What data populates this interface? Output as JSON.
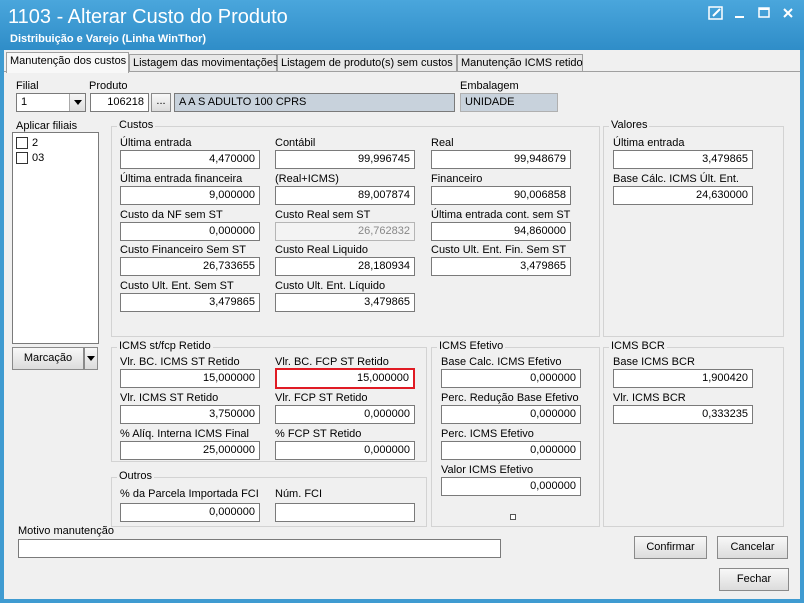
{
  "window": {
    "title": "1103 - Alterar Custo do Produto",
    "subtitle": "Distribuição e Varejo (Linha WinThor)"
  },
  "tabs": [
    {
      "label": "Manutenção dos custos"
    },
    {
      "label": "Listagem das movimentações"
    },
    {
      "label": "Listagem de produto(s)  sem custos"
    },
    {
      "label": "Manutenção ICMS retido"
    }
  ],
  "header": {
    "filial_label": "Filial",
    "filial_value": "1",
    "produto_label": "Produto",
    "produto_code": "106218",
    "browse_label": "...",
    "produto_desc": "A A S ADULTO 100 CPRS",
    "embalagem_label": "Embalagem",
    "embalagem_value": "UNIDADE"
  },
  "aplicar_filiais": {
    "label": "Aplicar filiais",
    "items": [
      {
        "label": "2",
        "checked": false
      },
      {
        "label": "03",
        "checked": false
      }
    ],
    "marcacao_label": "Marcação"
  },
  "custos": {
    "title": "Custos",
    "fields": {
      "ultima_entrada": {
        "label": "Última entrada",
        "value": "4,470000"
      },
      "contabil": {
        "label": "Contábil",
        "value": "99,996745"
      },
      "real": {
        "label": "Real",
        "value": "99,948679"
      },
      "ultima_entrada_financeira": {
        "label": "Última entrada financeira",
        "value": "9,000000"
      },
      "real_icms": {
        "label": "(Real+ICMS)",
        "value": "89,007874"
      },
      "financeiro": {
        "label": "Financeiro",
        "value": "90,006858"
      },
      "custo_nf_sem_st": {
        "label": "Custo da NF sem ST",
        "value": "0,000000"
      },
      "custo_real_sem_st": {
        "label": "Custo Real sem ST",
        "value": "26,762832"
      },
      "ultima_entrada_cont_sem_st": {
        "label": "Última entrada cont. sem ST",
        "value": "94,860000"
      },
      "custo_financeiro_sem_st": {
        "label": "Custo Financeiro Sem ST",
        "value": "26,733655"
      },
      "custo_real_liquido": {
        "label": "Custo Real Liquido",
        "value": "28,180934"
      },
      "custo_ult_ent_fin_sem_st": {
        "label": "Custo Ult. Ent. Fin. Sem ST",
        "value": "3,479865"
      },
      "custo_ult_ent_sem_st": {
        "label": "Custo Ult. Ent. Sem ST",
        "value": "3,479865"
      },
      "custo_ult_ent_liquido": {
        "label": "Custo Ult. Ent. Líquido",
        "value": "3,479865"
      }
    }
  },
  "valores": {
    "title": "Valores",
    "ultima_entrada": {
      "label": "Última entrada",
      "value": "3,479865"
    },
    "base_calc_icms": {
      "label": "Base Cálc. ICMS Últ. Ent.",
      "value": "24,630000"
    }
  },
  "icms_st": {
    "title": "ICMS st/fcp Retido",
    "vlr_bc_icms_st": {
      "label": "Vlr. BC. ICMS ST Retido",
      "value": "15,000000"
    },
    "vlr_bc_fcp_st": {
      "label": "Vlr. BC. FCP ST Retido",
      "value": "15,000000"
    },
    "vlr_icms_st": {
      "label": "Vlr. ICMS ST Retido",
      "value": "3,750000"
    },
    "vlr_fcp_st": {
      "label": "Vlr. FCP ST Retido",
      "value": "0,000000"
    },
    "aliq_interna": {
      "label": "% Alíq. Interna ICMS Final",
      "value": "25,000000"
    },
    "fcp_st": {
      "label": "% FCP ST Retido",
      "value": "0,000000"
    }
  },
  "icms_efetivo": {
    "title": "ICMS Efetivo",
    "base_calc": {
      "label": "Base Calc. ICMS Efetivo",
      "value": "0,000000"
    },
    "perc_reducao": {
      "label": "Perc. Redução Base Efetivo",
      "value": "0,000000"
    },
    "perc_icms": {
      "label": "Perc. ICMS Efetivo",
      "value": "0,000000"
    },
    "valor_icms": {
      "label": "Valor ICMS Efetivo",
      "value": "0,000000"
    }
  },
  "icms_bcr": {
    "title": "ICMS BCR",
    "base": {
      "label": "Base ICMS BCR",
      "value": "1,900420"
    },
    "vlr": {
      "label": "Vlr. ICMS BCR",
      "value": "0,333235"
    }
  },
  "outros": {
    "title": "Outros",
    "perc_fci": {
      "label": "% da Parcela Importada FCI",
      "value": "0,000000"
    },
    "num_fci": {
      "label": "Núm. FCI",
      "value": ""
    }
  },
  "motivo": {
    "label": "Motivo manutenção",
    "value": ""
  },
  "buttons": {
    "confirmar": "Confirmar",
    "cancelar": "Cancelar",
    "fechar": "Fechar"
  }
}
